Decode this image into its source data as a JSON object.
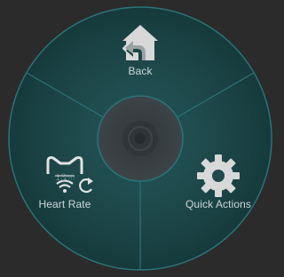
{
  "wheel": {
    "items": [
      {
        "label": "Back",
        "icon": "home-back-icon"
      },
      {
        "label": "Heart Rate",
        "icon": "heart-rate-device-icon",
        "battery_text": "13%"
      },
      {
        "label": "Quick Actions",
        "icon": "gear-icon"
      }
    ]
  },
  "colors": {
    "background": "#2b2b2b",
    "wheel_fill": "#1e4a4c",
    "wheel_ring": "#2a6e72",
    "center_fill": "#3a3f42",
    "icon": "#d8d8d8"
  }
}
